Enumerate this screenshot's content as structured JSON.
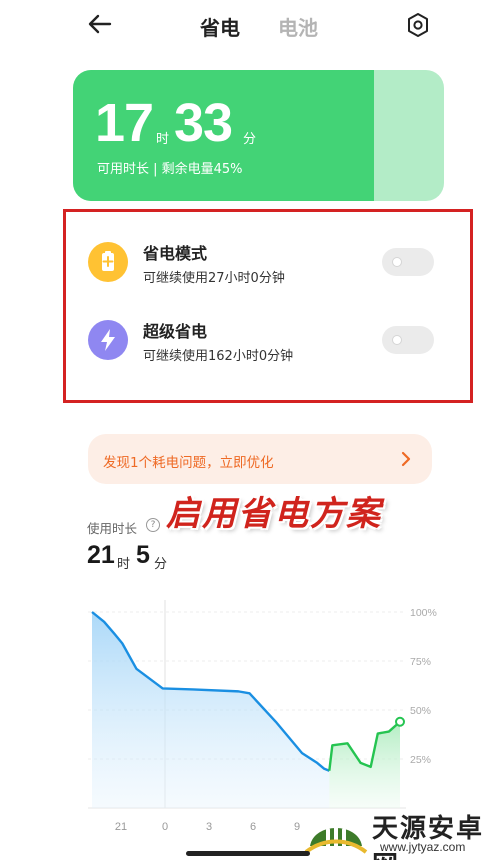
{
  "header": {
    "tabs": [
      {
        "label": "省电",
        "active": true
      },
      {
        "label": "电池",
        "active": false
      }
    ]
  },
  "time_card": {
    "hours": "17",
    "hours_unit": "时",
    "minutes": "33",
    "minutes_unit": "分",
    "subtitle": "可用时长 | 剩余电量45%",
    "battery_level": 0.45
  },
  "modes": [
    {
      "title": "省电模式",
      "subtitle": "可继续使用27小时0分钟",
      "icon": "battery-plus-icon",
      "icon_color": "#ffc233",
      "enabled": false
    },
    {
      "title": "超级省电",
      "subtitle": "可继续使用162小时0分钟",
      "icon": "lightning-icon",
      "icon_color": "#8f87f1",
      "enabled": false
    }
  ],
  "alert": {
    "text": "发现1个耗电问题，立即优化"
  },
  "overlay_caption": "启用省电方案",
  "usage": {
    "label": "使用时长",
    "hours": "21",
    "hours_unit": "时",
    "minutes": "5",
    "minutes_unit": "分"
  },
  "chart_data": {
    "type": "line",
    "y_tick_labels": [
      "100%",
      "75%",
      "50%",
      "25%"
    ],
    "x_tick_labels": [
      "21",
      "0",
      "3",
      "6",
      "9"
    ],
    "ylim": [
      0,
      100
    ],
    "series": [
      {
        "points": [
          [
            0.0,
            100
          ],
          [
            1.2,
            95
          ],
          [
            2.2,
            89
          ],
          [
            3.0,
            84
          ],
          [
            4.4,
            71
          ],
          [
            7.0,
            61
          ],
          [
            10.0,
            60.5
          ],
          [
            14.5,
            59.5
          ],
          [
            15.6,
            58.5
          ],
          [
            18.2,
            44
          ],
          [
            20.8,
            28
          ],
          [
            22.3,
            23
          ],
          [
            23.0,
            20
          ],
          [
            23.5,
            19
          ],
          [
            23.8,
            32
          ],
          [
            25.3,
            33
          ],
          [
            26.6,
            23
          ],
          [
            27.6,
            21
          ],
          [
            28.3,
            38
          ],
          [
            29.4,
            39
          ],
          [
            30.5,
            44
          ]
        ]
      }
    ],
    "colors": {
      "discharging": "#1a8fe2",
      "charging": "#25c451"
    }
  },
  "watermark": {
    "title": "天源安卓网",
    "url": "www.jytyaz.com"
  }
}
